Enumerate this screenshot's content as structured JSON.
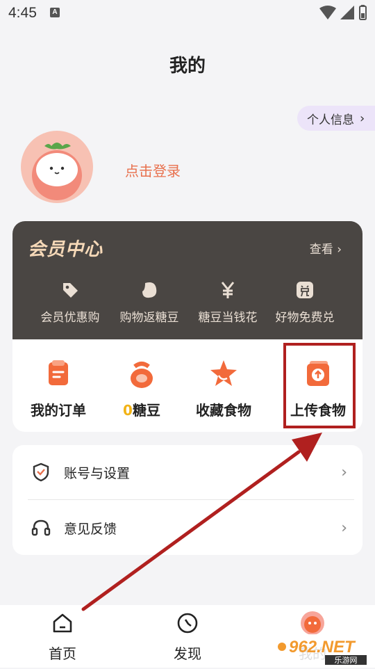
{
  "status_bar": {
    "time": "4:45",
    "notification_letter": "A"
  },
  "page_title": "我的",
  "profile_info_label": "个人信息",
  "login_text": "点击登录",
  "member_center": {
    "title": "会员中心",
    "view_label": "查看",
    "benefits": [
      {
        "label": "会员优惠购",
        "icon": "tag-icon"
      },
      {
        "label": "购物返糖豆",
        "icon": "bean-icon"
      },
      {
        "label": "糖豆当钱花",
        "icon": "yen-icon"
      },
      {
        "label": "好物免费兑",
        "icon": "redeem-icon"
      }
    ]
  },
  "shortcuts": [
    {
      "label": "我的订单",
      "icon": "order-icon"
    },
    {
      "count": "0",
      "label": "糖豆",
      "icon": "bean-bag-icon"
    },
    {
      "label": "收藏食物",
      "icon": "star-icon"
    },
    {
      "label": "上传食物",
      "icon": "upload-icon"
    }
  ],
  "settings": [
    {
      "label": "账号与设置",
      "icon": "shield-icon"
    },
    {
      "label": "意见反馈",
      "icon": "headset-icon"
    }
  ],
  "bottom_nav": [
    {
      "label": "首页",
      "icon": "home-icon"
    },
    {
      "label": "发现",
      "icon": "compass-icon"
    },
    {
      "label": "我的",
      "icon": "profile-tab-icon"
    }
  ],
  "watermark": {
    "brand": "962.NET",
    "sub": "乐游网"
  },
  "colors": {
    "accent": "#e8704d",
    "member_bg": "#4a4643",
    "member_gold": "#f6d9b8",
    "highlight": "#b0201f",
    "bean_yellow": "#f2b316",
    "pill_bg": "#ece4f9"
  }
}
